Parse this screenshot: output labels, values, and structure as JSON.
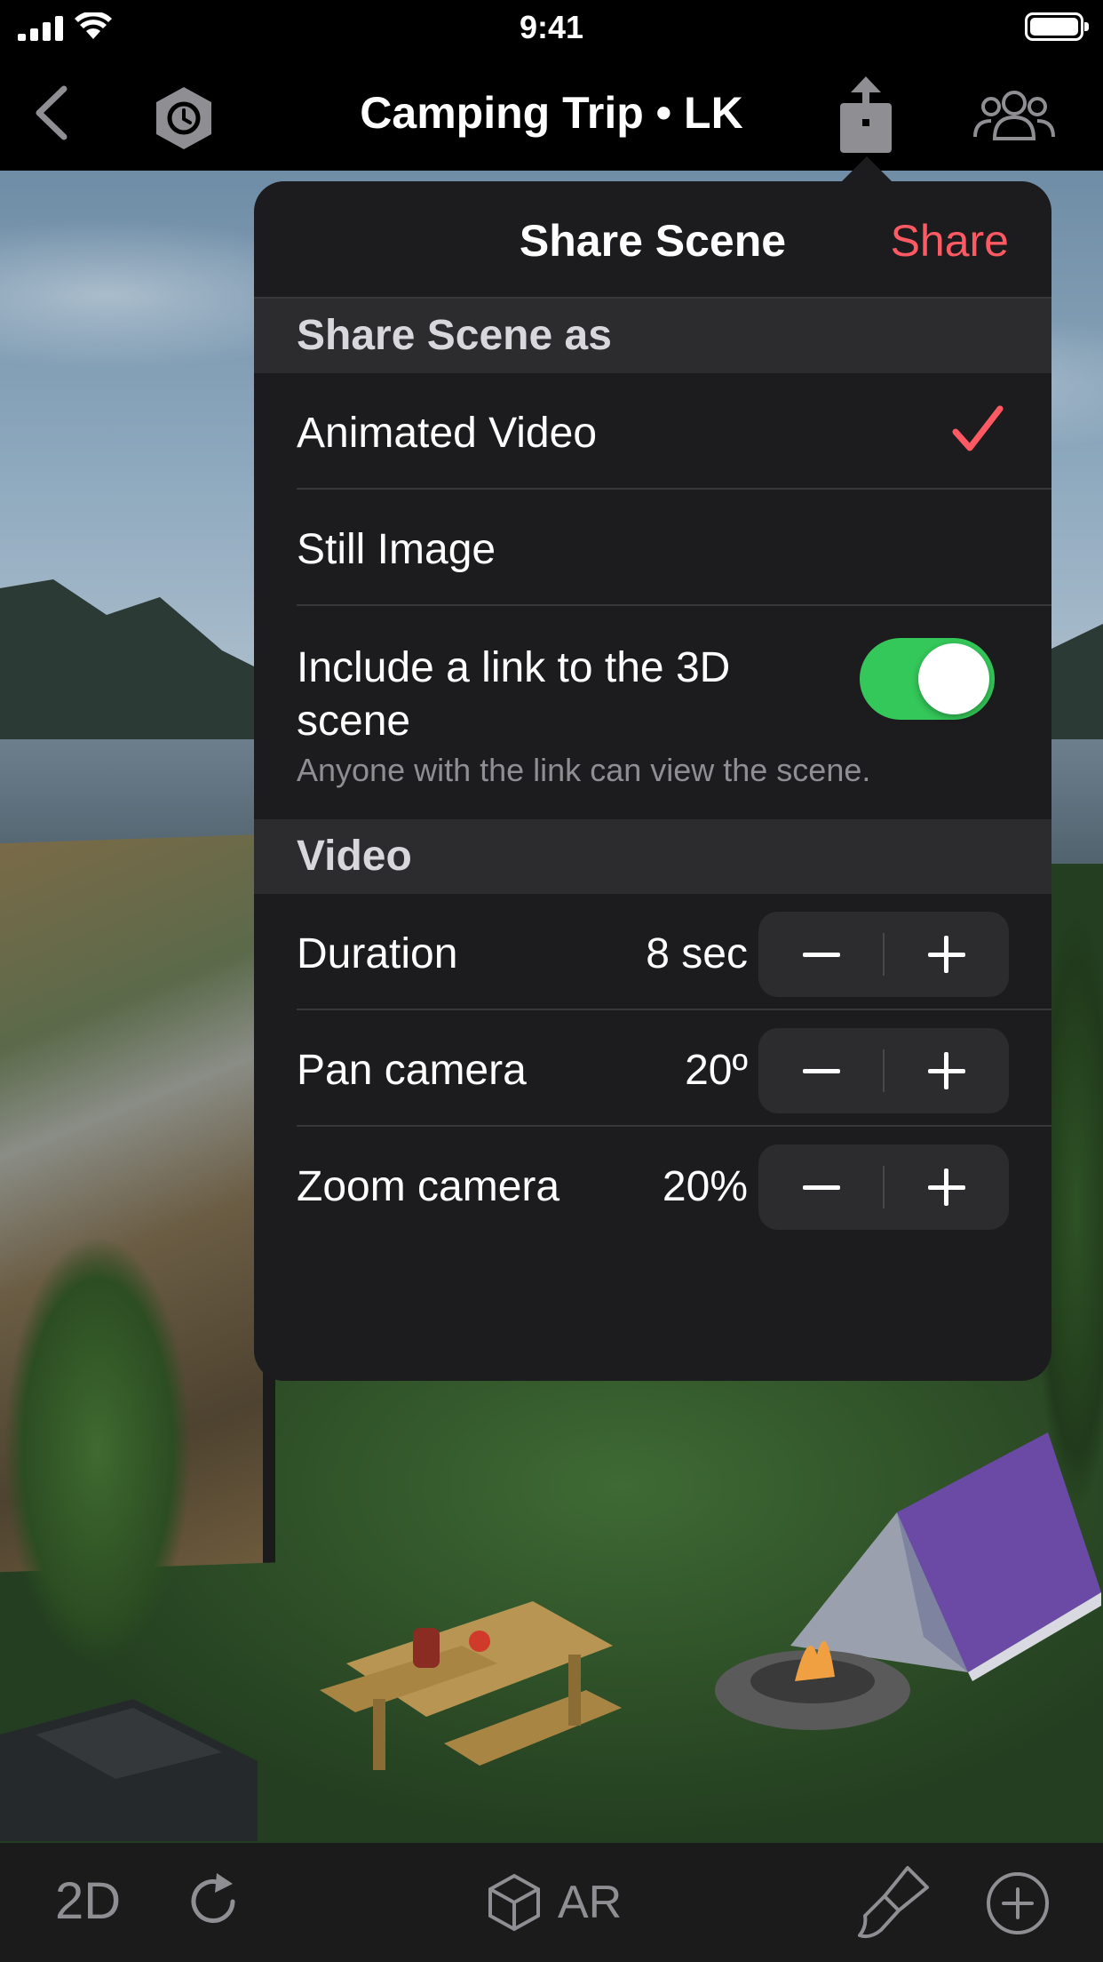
{
  "status_bar": {
    "time": "9:41"
  },
  "nav_bar": {
    "title": "Camping Trip • LK"
  },
  "share_popover": {
    "title": "Share Scene",
    "share_action": "Share",
    "accent_color": "#ff5a63",
    "share_as_section": {
      "header": "Share Scene as",
      "options": [
        {
          "label": "Animated Video",
          "selected": true
        },
        {
          "label": "Still Image",
          "selected": false
        }
      ],
      "include_link": {
        "label": "Include a link to the 3D scene",
        "enabled": true,
        "footnote": "Anyone with the link can view the scene."
      }
    },
    "video_section": {
      "header": "Video",
      "settings": [
        {
          "label": "Duration",
          "value": "8 sec"
        },
        {
          "label": "Pan camera",
          "value": "20º"
        },
        {
          "label": "Zoom camera",
          "value": "20%"
        }
      ]
    }
  },
  "toolbar": {
    "mode_2d_label": "2D",
    "ar_label": "AR"
  },
  "icons": {
    "back": "chevron-left-icon",
    "history": "clock-hexagon-icon",
    "share": "share-icon",
    "collaborators": "people-icon",
    "rotate": "rotate-icon",
    "ar": "cube-icon",
    "brush": "paintbrush-icon",
    "add": "plus-circle-icon"
  },
  "colors": {
    "toggle_on": "#34c759",
    "popover_bg": "#1c1c1e",
    "section_header_bg": "#2c2c2e"
  }
}
